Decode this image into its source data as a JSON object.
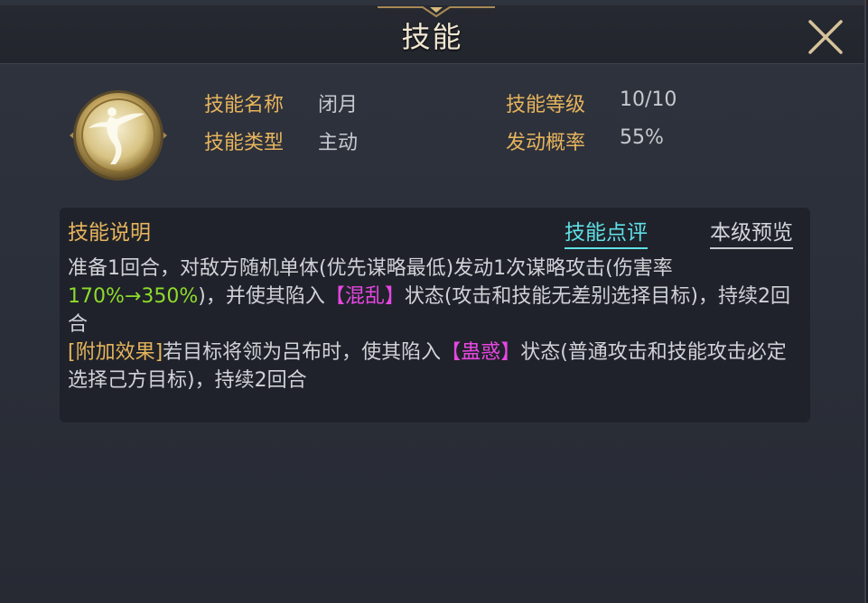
{
  "dialog": {
    "title": "技能",
    "close_icon": "close-icon"
  },
  "skill": {
    "icon": "dancer-emblem-icon",
    "name_label": "技能名称",
    "name_value": "闭月",
    "type_label": "技能类型",
    "type_value": "主动",
    "level_label": "技能等级",
    "level_value": "10/10",
    "chance_label": "发动概率",
    "chance_value": "55%"
  },
  "description": {
    "title": "技能说明",
    "review_link": "技能点评",
    "preview_link": "本级预览",
    "line1_a": "准备1回合，对敌方随机单体(优先谋略最低)发动1次谋略攻击(伤害率",
    "line1_b": "170%→350%",
    "line1_c": ")，并使其陷入",
    "line1_d": "【混乱】",
    "line1_e": "状态(攻击和技能无差别选择目标)，持续2回合",
    "line2_a": "[附加效果]",
    "line2_b": "若目标将领为吕布时，使其陷入",
    "line2_c": "【蛊惑】",
    "line2_d": "状态(普通攻击和技能攻击必定选择己方目标)，持续2回合"
  },
  "colors": {
    "label_gold": "#e6b45c",
    "value_gray": "#c7c9cf",
    "highlight_green": "#8edb2c",
    "highlight_pink": "#e746e2",
    "link_cyan": "#5fe0e6"
  }
}
